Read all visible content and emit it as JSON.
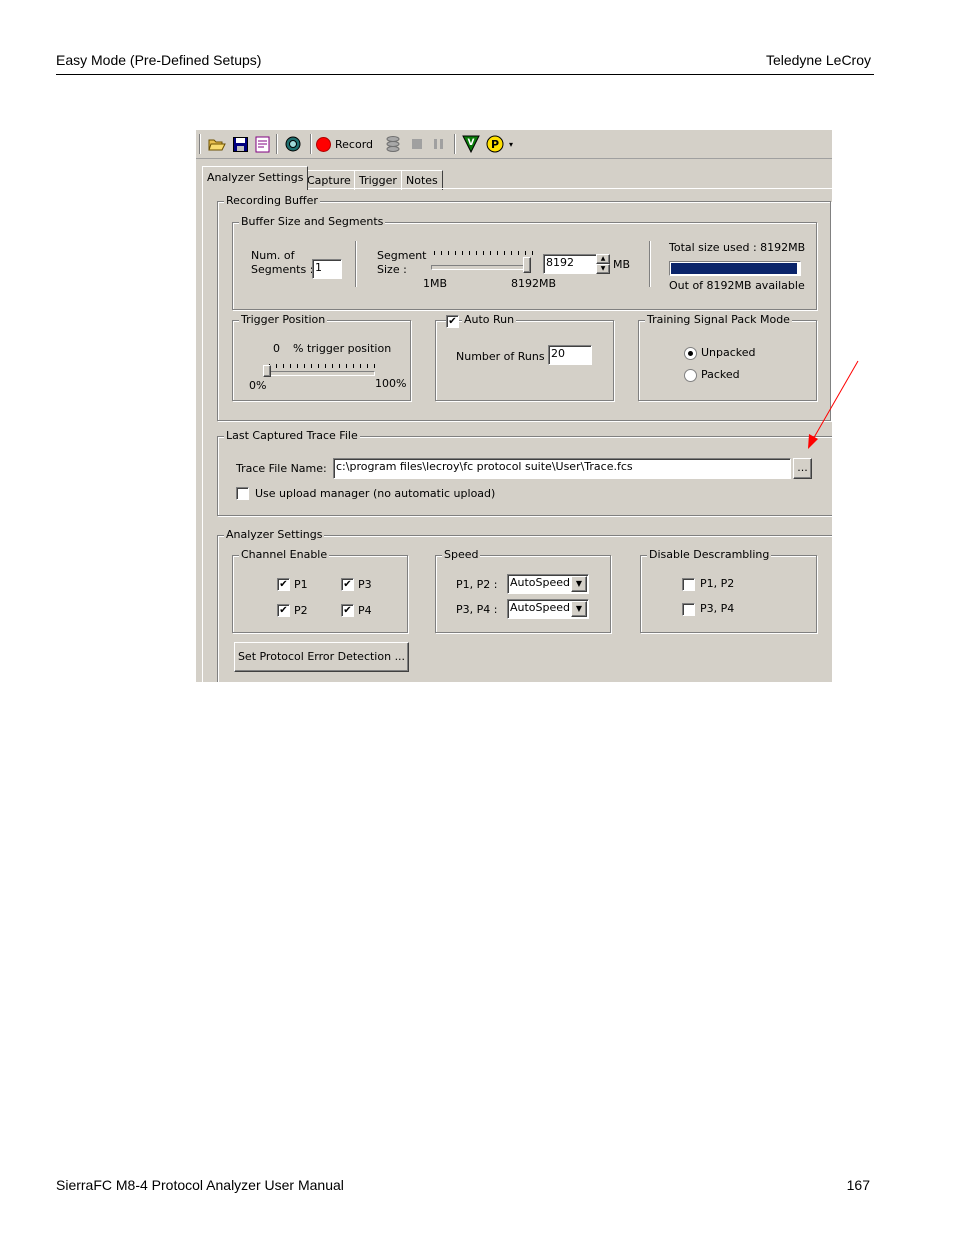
{
  "page": {
    "header_left": "Easy Mode (Pre-Defined Setups)",
    "header_right": "Teledyne  LeCroy",
    "footer_left": "SierraFC M8-4 Protocol Analyzer User Manual",
    "footer_right": "167"
  },
  "toolbar": {
    "record_label": "Record",
    "icons": [
      "open-folder-icon",
      "save-icon",
      "report-icon",
      "globe-icon",
      "record-icon",
      "stack-icon",
      "stop-icon",
      "pause-icon",
      "v-icon",
      "p-icon",
      "dropdown-arrow-icon"
    ]
  },
  "tabs": [
    {
      "label": "Analyzer Settings",
      "active": true
    },
    {
      "label": "Capture",
      "active": false
    },
    {
      "label": "Trigger",
      "active": false
    },
    {
      "label": "Notes",
      "active": false
    }
  ],
  "recording_buffer": {
    "title": "Recording Buffer",
    "buffer": {
      "title": "Buffer Size and Segments",
      "num_segments_label_1": "Num. of",
      "num_segments_label_2": "Segments :",
      "num_segments_value": "1",
      "segment_size_label_1": "Segment",
      "segment_size_label_2": "Size :",
      "segment_size_value": "8192",
      "segment_size_unit": "MB",
      "slider_min_label": "1MB",
      "slider_max_label": "8192MB",
      "slider_fraction": 1.0,
      "total_used": "Total size used : 8192MB",
      "available": "Out of 8192MB available",
      "usage_fraction": 1.0,
      "bar_color": "#0a246a"
    },
    "trigger_position": {
      "title": "Trigger Position",
      "value": "0",
      "value_label": "% trigger position",
      "min_label": "0%",
      "max_label": "100%",
      "slider_fraction": 0.0
    },
    "auto_run": {
      "label": "Auto Run",
      "checked": true,
      "runs_label": "Number of Runs :",
      "runs_value": "20"
    },
    "training": {
      "title": "Training Signal Pack Mode",
      "options": [
        {
          "label": "Unpacked",
          "selected": true
        },
        {
          "label": "Packed",
          "selected": false
        }
      ]
    }
  },
  "trace": {
    "title": "Last Captured Trace File",
    "file_label": "Trace File Name:",
    "file_value": "c:\\program files\\lecroy\\fc protocol suite\\User\\Trace.fcs",
    "browse_label": "...",
    "upload_label": "Use upload manager (no automatic upload)",
    "upload_checked": false
  },
  "analyzer": {
    "title": "Analyzer Settings",
    "channel": {
      "title": "Channel Enable",
      "items": [
        {
          "label": "P1",
          "checked": true
        },
        {
          "label": "P3",
          "checked": true
        },
        {
          "label": "P2",
          "checked": true
        },
        {
          "label": "P4",
          "checked": true
        }
      ]
    },
    "speed": {
      "title": "Speed",
      "p12_label": "P1, P2 :",
      "p12_value": "AutoSpeed",
      "p34_label": "P3, P4 :",
      "p34_value": "AutoSpeed"
    },
    "descrambling": {
      "title": "Disable Descrambling",
      "items": [
        {
          "label": "P1, P2",
          "checked": false
        },
        {
          "label": "P3, P4",
          "checked": false
        }
      ]
    },
    "error_button": "Set Protocol Error Detection ..."
  },
  "annotation": {
    "arrow_color": "#ff0000"
  }
}
